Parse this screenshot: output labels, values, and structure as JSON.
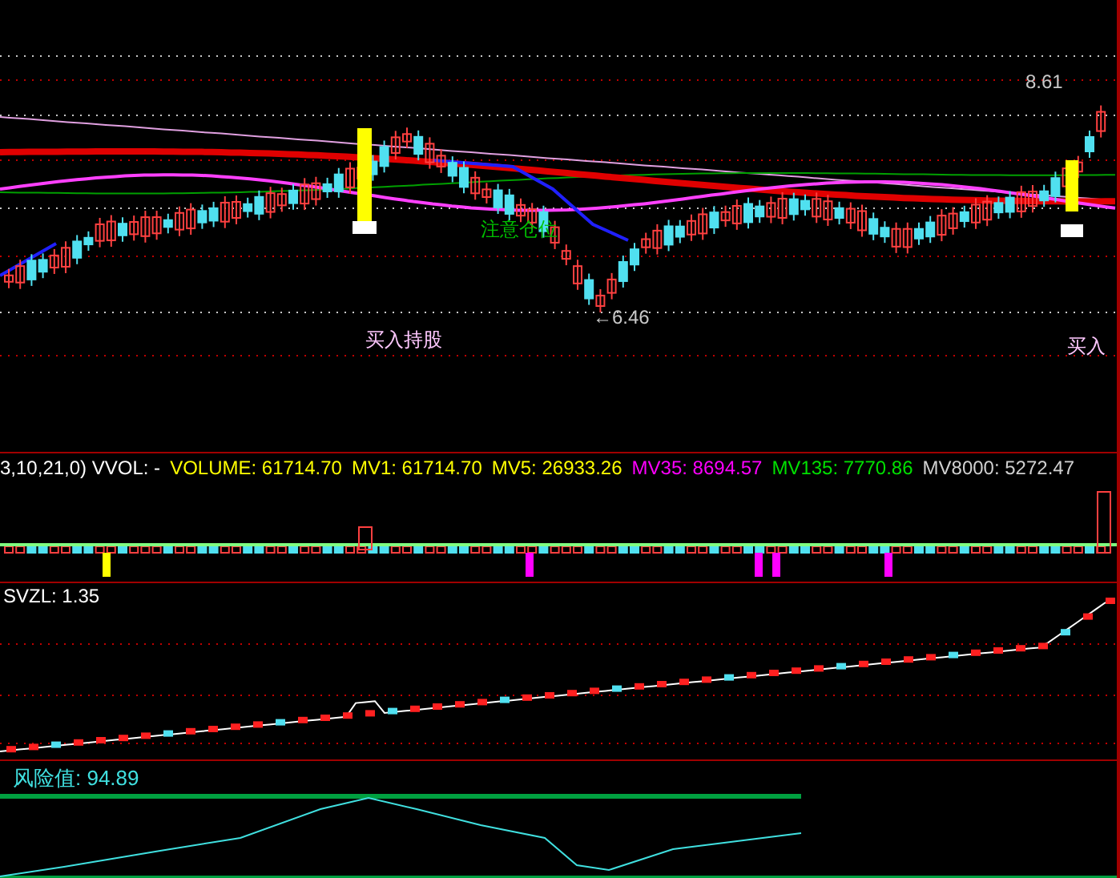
{
  "main_chart": {
    "labels": [
      {
        "kind": "price",
        "text": "8.61"
      },
      {
        "kind": "signal",
        "text": "买入持股"
      },
      {
        "kind": "warning",
        "text": "注意仓位"
      },
      {
        "kind": "price",
        "text": "←6.46"
      },
      {
        "kind": "signal",
        "text": "买入"
      }
    ]
  },
  "volume_panel": {
    "title": "3,10,21,0) VVOL: -",
    "readings": [
      {
        "text": "VOLUME: 61714.70",
        "color": "#ffff00"
      },
      {
        "text": "MV1: 61714.70",
        "color": "#ffff00"
      },
      {
        "text": "MV5: 26933.26",
        "color": "#ffff00"
      },
      {
        "text": "MV35: 8694.57",
        "color": "#ff00ff"
      },
      {
        "text": "MV135: 7770.86",
        "color": "#00e000"
      },
      {
        "text": "MV8000: 5272.47",
        "color": "#d0d0d0"
      }
    ]
  },
  "svzl_panel": {
    "title": "SVZL: 1.35"
  },
  "risk_panel": {
    "title": "风险值: 94.89"
  }
}
